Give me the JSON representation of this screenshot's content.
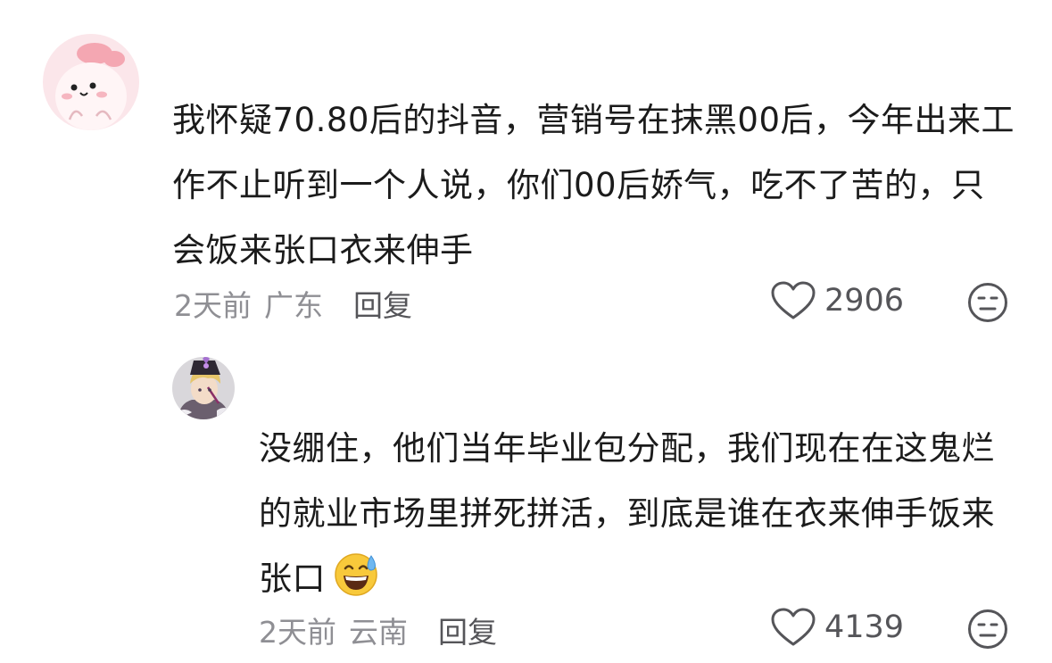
{
  "comments": [
    {
      "text": "我怀疑70.80后的抖音，营销号在抹黑00后，今年出来工作不止听到一个人说，你们00后娇气，吃不了苦的，只会饭来张口衣来伸手",
      "time": "2天前",
      "region": "广东",
      "reply_label": "回复",
      "likes": "2906",
      "avatar_icon": "pink-bunny-avatar-icon"
    },
    {
      "text": "没绷住，他们当年毕业包分配，我们现在在这鬼烂的就业市场里拼死拼活，到底是谁在衣来伸手饭来张口",
      "emoji": "sweat-smile-emoji",
      "time": "2天前",
      "region": "云南",
      "reply_label": "回复",
      "likes": "4139",
      "avatar_icon": "anime-character-avatar-icon"
    }
  ],
  "colors": {
    "text": "#1b1b1b",
    "meta": "#8f8f94",
    "action": "#555559",
    "background": "#ffffff"
  }
}
